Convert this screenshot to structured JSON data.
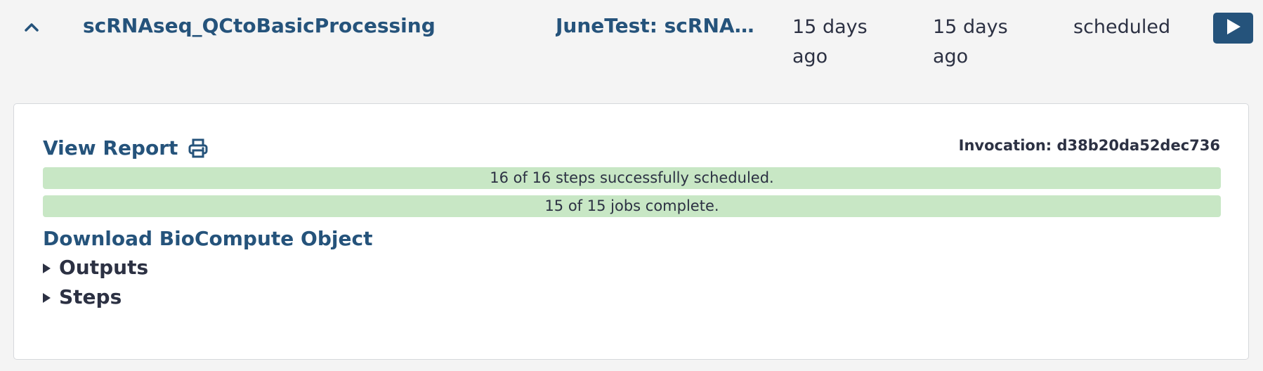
{
  "workflow_row": {
    "name": "scRNAseq_QCtoBasicProcessing",
    "history": "JuneTest: scRNAseq_QCtoBasicProcessing",
    "created": "15 days ago",
    "updated": "15 days ago",
    "state": "scheduled",
    "icons": {
      "collapse": "chevron-up-icon",
      "run": "play-icon"
    }
  },
  "invocation_panel": {
    "view_report_label": "View Report",
    "print_icon": "print-icon",
    "invocation_label": "Invocation: d38b20da52dec736",
    "steps_status": "16 of 16 steps successfully scheduled.",
    "jobs_status": "15 of 15 jobs complete.",
    "download_label": "Download BioCompute Object",
    "outputs_label": "Outputs",
    "steps_label": "Steps",
    "status_color": "#c8e7c5",
    "link_color": "#25537b"
  }
}
